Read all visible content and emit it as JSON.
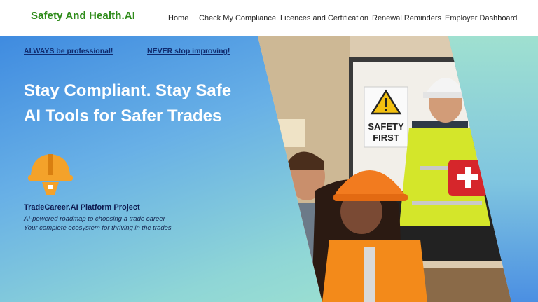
{
  "header": {
    "logo": "Safety And Health.AI",
    "nav": [
      {
        "label": "Home",
        "active": true
      },
      {
        "label": "Check My Compliance"
      },
      {
        "label": "Licences and Certification"
      },
      {
        "label": "Renewal Reminders"
      },
      {
        "label": "Employer Dashboard"
      }
    ]
  },
  "hero": {
    "tagline_left": "ALWAYS be professional!",
    "tagline_right": "NEVER stop improving!",
    "headline_1": "Stay Compliant. Stay Safe",
    "headline_2": "AI Tools for Safer Trades",
    "icon": "hard-hat-icon",
    "project_title": "TradeCareer.AI Platform Project",
    "project_line_1": "AI-powered roadmap to choosing a trade career",
    "project_line_2": "Your complete ecosystem for thriving in the trades",
    "photo": {
      "sign_text_1": "SAFETY",
      "sign_text_2": "FIRST"
    }
  }
}
